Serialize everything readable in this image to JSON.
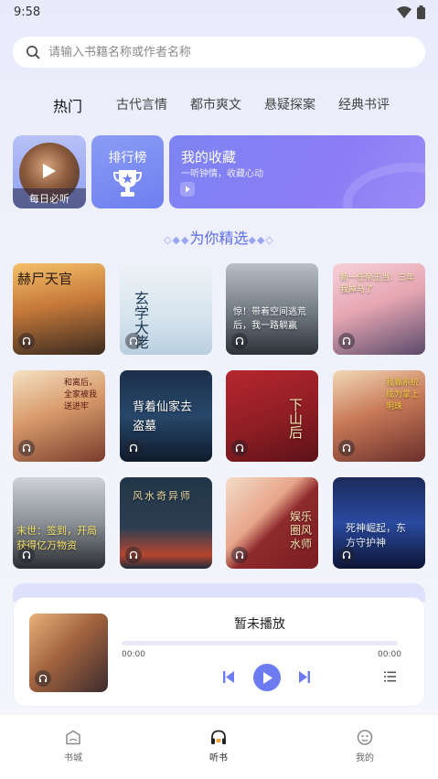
{
  "status_bar": {
    "time": "9:58"
  },
  "search": {
    "placeholder": "请输入书籍名称或作者名称"
  },
  "tabs": [
    {
      "label": "热门",
      "active": true
    },
    {
      "label": "古代言情",
      "active": false
    },
    {
      "label": "都市爽文",
      "active": false
    },
    {
      "label": "悬疑探案",
      "active": false
    },
    {
      "label": "经典书评",
      "active": false
    }
  ],
  "features": {
    "daily": {
      "label": "每日必听"
    },
    "rank": {
      "label": "排行榜"
    },
    "favorites": {
      "title": "我的收藏",
      "subtitle": "一听钟情，收藏心动"
    }
  },
  "section": {
    "title": "为你精选"
  },
  "books": [
    {
      "cover_text": "赫尸天官"
    },
    {
      "cover_text": "玄学大佬"
    },
    {
      "cover_text": "惊！带着空间逃荒后，我一路躺赢"
    },
    {
      "cover_text": "新一任帝王当：三年我掉马了"
    },
    {
      "cover_text": "和离后，全家被我送进牢"
    },
    {
      "cover_text": "背着仙家去盗墓"
    },
    {
      "cover_text": "下山后"
    },
    {
      "cover_text": "我靠系统成为掌上明珠"
    },
    {
      "cover_text": "末世：签到，开局获得亿万物资"
    },
    {
      "cover_text": "风水奇异师"
    },
    {
      "cover_text": "娱乐圈风水师"
    },
    {
      "cover_text": "死神崛起，东方守护神"
    }
  ],
  "player": {
    "title": "暂未播放",
    "current_time": "00:00",
    "total_time": "00:00",
    "progress": 0
  },
  "bottom_nav": [
    {
      "label": "书城",
      "active": false
    },
    {
      "label": "听书",
      "active": true
    },
    {
      "label": "我的",
      "active": false
    }
  ],
  "colors": {
    "accent": "#6c7cf0",
    "favorites_card": "#8b7cf5",
    "rank_card": "#7a8cf3"
  }
}
